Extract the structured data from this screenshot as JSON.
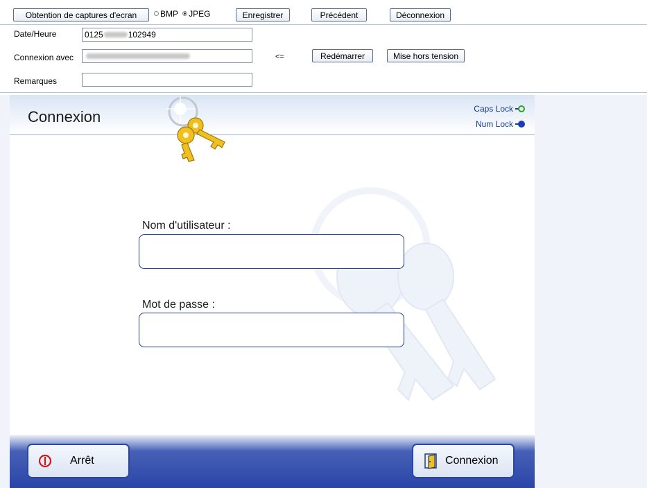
{
  "toolbar": {
    "capture_label": "Obtention de captures d'ecran",
    "format_bmp": "BMP",
    "format_jpeg": "JPEG",
    "selected_format": "JPEG",
    "save_label": "Enregistrer",
    "previous_label": "Précédent",
    "logout_label": "Déconnexion"
  },
  "info": {
    "date_label": "Date/Heure",
    "date_value_start": "0125",
    "date_value_end": "102949",
    "connection_label": "Connexion avec",
    "arrow": "<=",
    "restart_label": "Redémarrer",
    "shutdown_label": "Mise hors tension",
    "remarks_label": "Remarques",
    "remarks_value": ""
  },
  "panel": {
    "title": "Connexion",
    "caps_lock": "Caps Lock",
    "num_lock": "Num Lock",
    "caps_color": "#2a9a3a",
    "num_color": "#1a3ab8",
    "username_label": "Nom d'utilisateur :",
    "username_value": "",
    "password_label": "Mot de passe :",
    "password_value": ""
  },
  "footer": {
    "stop_label": "Arrêt",
    "login_label": "Connexion"
  },
  "icons": [
    "keys-icon",
    "power-icon",
    "door-icon",
    "watermark-keys-icon"
  ]
}
